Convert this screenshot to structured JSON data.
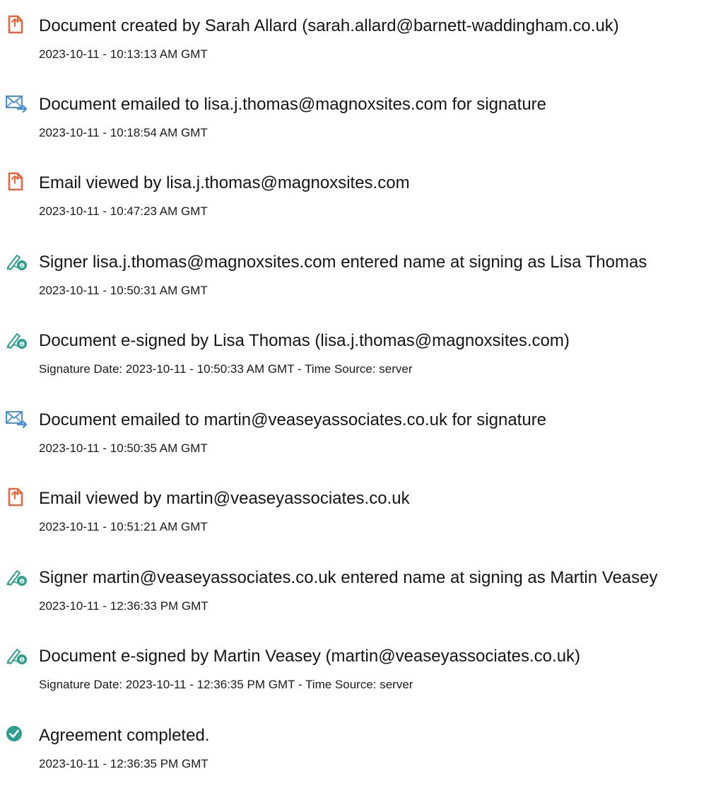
{
  "events": [
    {
      "icon": "document-created-icon",
      "title": "Document created by Sarah Allard (sarah.allard@barnett-waddingham.co.uk)",
      "time": "2023-10-11 - 10:13:13 AM GMT"
    },
    {
      "icon": "email-sent-icon",
      "title": "Document emailed to lisa.j.thomas@magnoxsites.com for signature",
      "time": "2023-10-11 - 10:18:54 AM GMT"
    },
    {
      "icon": "email-viewed-icon",
      "title": "Email viewed by lisa.j.thomas@magnoxsites.com",
      "time": "2023-10-11 - 10:47:23 AM GMT"
    },
    {
      "icon": "e-sign-pen-icon",
      "title": "Signer lisa.j.thomas@magnoxsites.com entered name at signing as Lisa Thomas",
      "time": "2023-10-11 - 10:50:31 AM GMT"
    },
    {
      "icon": "e-sign-pen-icon",
      "title": "Document e-signed by Lisa Thomas (lisa.j.thomas@magnoxsites.com)",
      "time": "Signature Date: 2023-10-11 - 10:50:33 AM GMT - Time Source: server"
    },
    {
      "icon": "email-sent-icon",
      "title": "Document emailed to martin@veaseyassociates.co.uk for signature",
      "time": "2023-10-11 - 10:50:35 AM GMT"
    },
    {
      "icon": "email-viewed-icon",
      "title": "Email viewed by martin@veaseyassociates.co.uk",
      "time": "2023-10-11 - 10:51:21 AM GMT"
    },
    {
      "icon": "e-sign-pen-icon",
      "title": "Signer martin@veaseyassociates.co.uk entered name at signing as Martin Veasey",
      "time": "2023-10-11 - 12:36:33 PM GMT"
    },
    {
      "icon": "e-sign-pen-icon",
      "title": "Document e-signed by Martin Veasey (martin@veaseyassociates.co.uk)",
      "time": "Signature Date: 2023-10-11 - 12:36:35 PM GMT - Time Source: server"
    },
    {
      "icon": "check-circle-icon",
      "title": "Agreement completed.",
      "time": "2023-10-11 - 12:36:35 PM GMT"
    }
  ],
  "colors": {
    "document_icon": "#e8643c",
    "email_icon": "#4a90d9",
    "sign_icon": "#2e9e8f",
    "check_icon": "#2e9e8f"
  }
}
